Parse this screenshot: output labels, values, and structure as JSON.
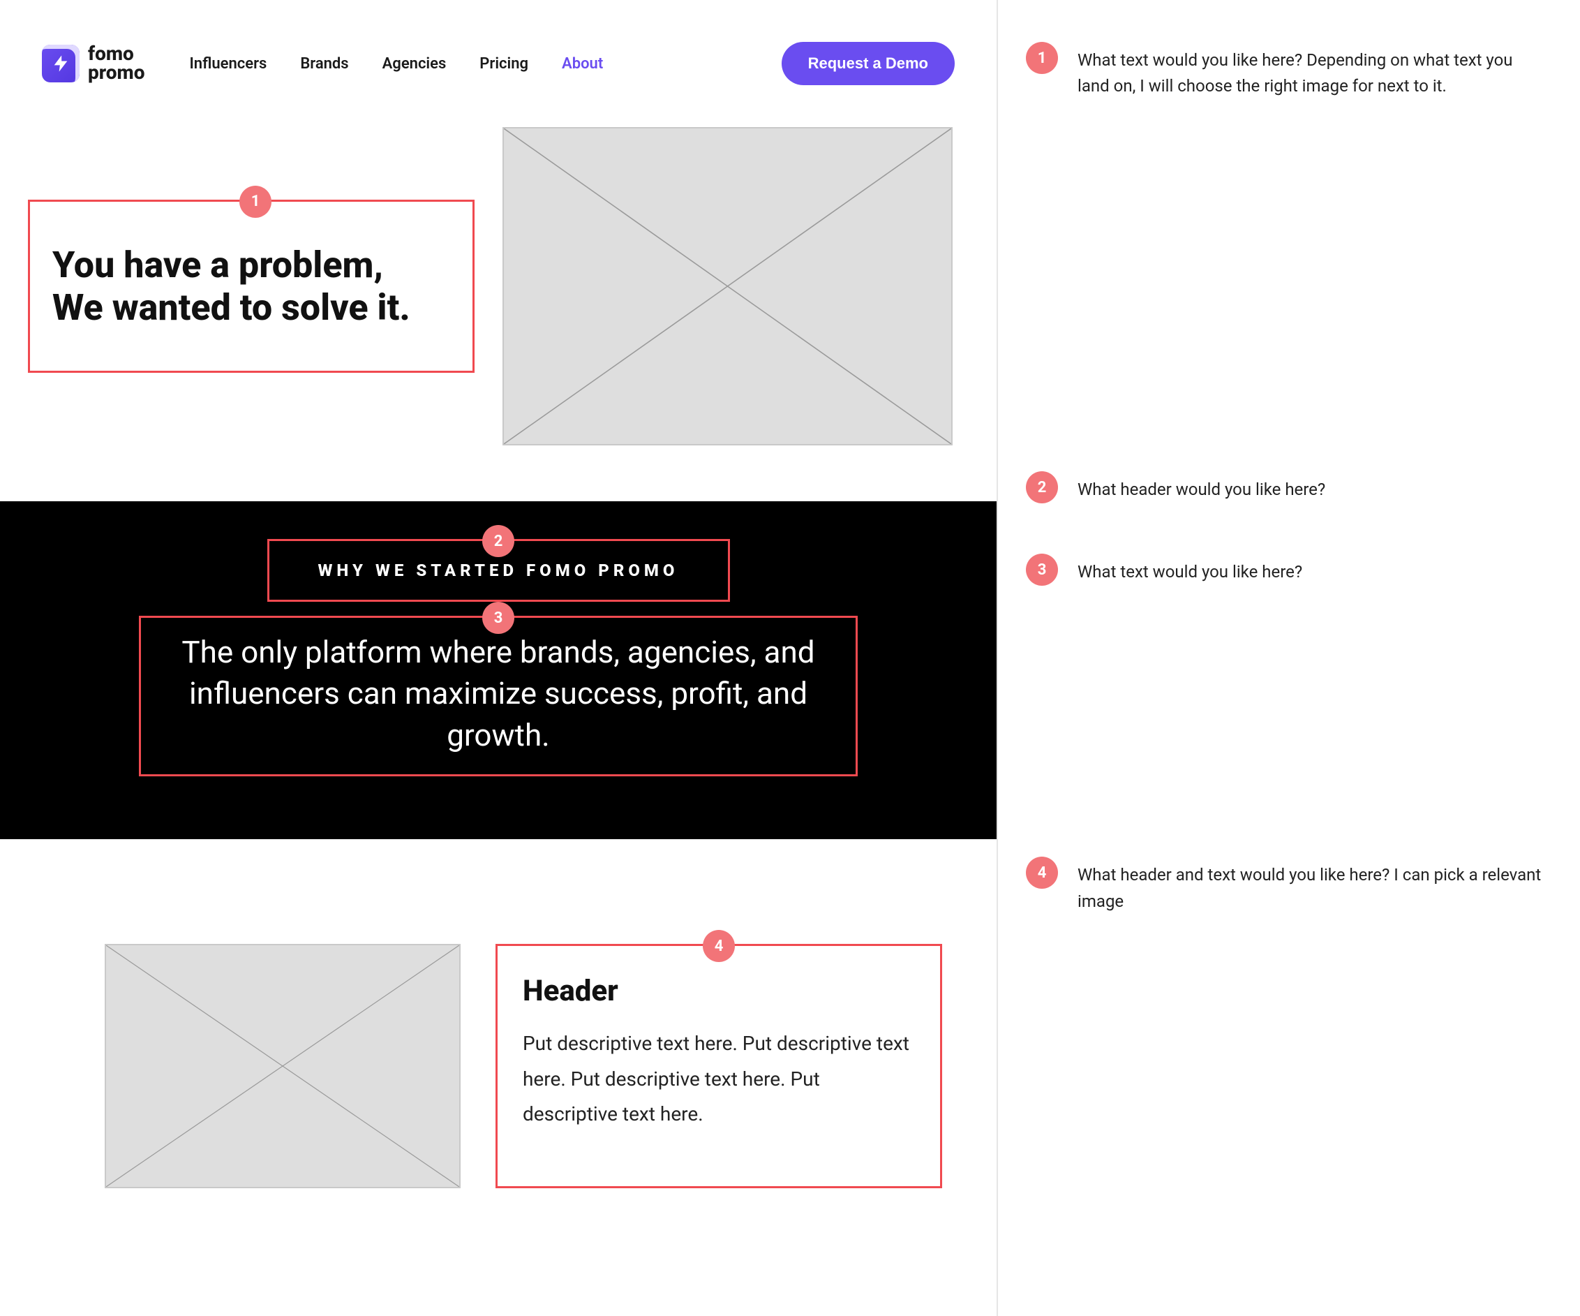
{
  "brand": {
    "logo_line1": "fomo",
    "logo_line2": "promo"
  },
  "nav": {
    "items": [
      {
        "label": "Influencers",
        "active": false
      },
      {
        "label": "Brands",
        "active": false
      },
      {
        "label": "Agencies",
        "active": false
      },
      {
        "label": "Pricing",
        "active": false
      },
      {
        "label": "About",
        "active": true
      }
    ],
    "cta_label": "Request a Demo"
  },
  "hero": {
    "headline": "You have a problem,\nWe wanted to solve it."
  },
  "why": {
    "eyebrow": "WHY WE STARTED FOMO PROMO",
    "headline": "The only platform where brands, agencies, and influencers can maximize success, profit, and growth."
  },
  "feature": {
    "header": "Header",
    "body": "Put descriptive text here. Put descriptive text here. Put descriptive text here. Put descriptive text here."
  },
  "annotations": {
    "badges": {
      "b1": "1",
      "b2": "2",
      "b3": "3",
      "b4": "4"
    }
  },
  "comments": [
    {
      "num": "1",
      "text": "What text would you like here? Depending on what text you land on, I will choose the right image for next to it."
    },
    {
      "num": "2",
      "text": "What header would you like here?"
    },
    {
      "num": "3",
      "text": "What text would you like here?"
    },
    {
      "num": "4",
      "text": "What header and text would you like here? I can pick a relevant image"
    }
  ]
}
